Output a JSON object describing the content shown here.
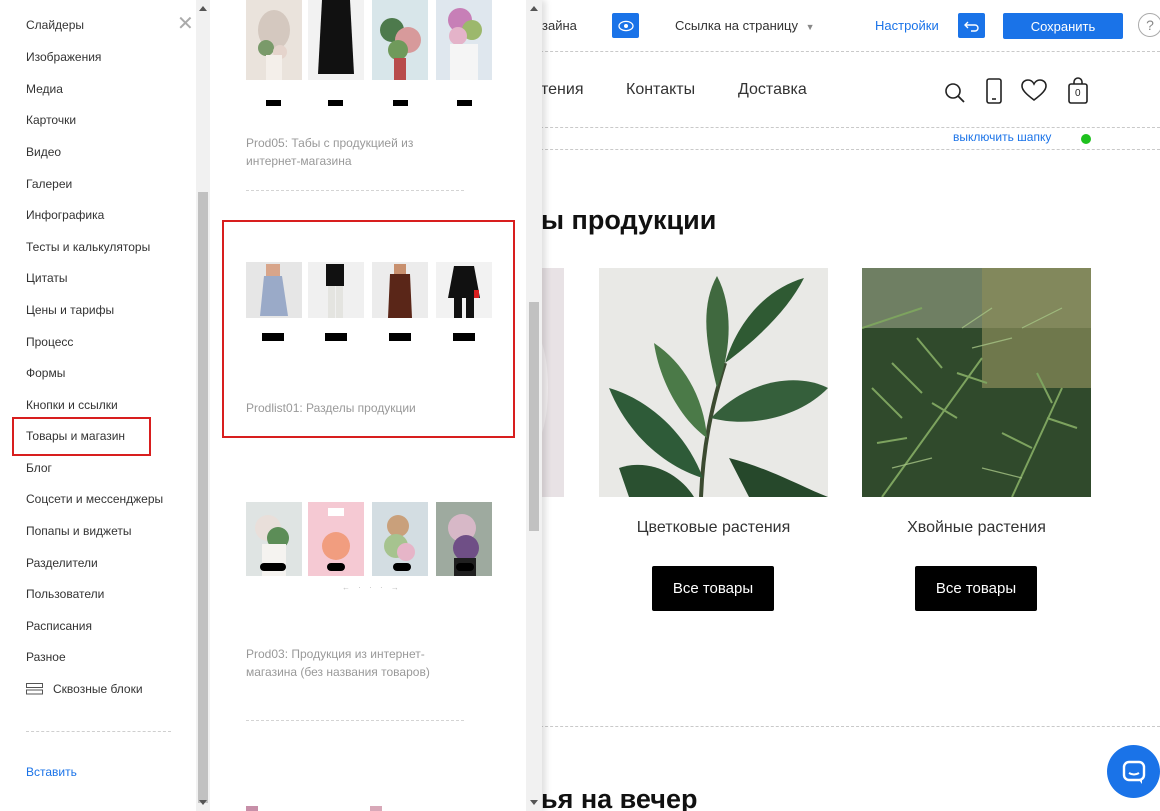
{
  "sidebar": {
    "items": [
      "Слайдеры",
      "Изображения",
      "Медиа",
      "Карточки",
      "Видео",
      "Галереи",
      "Инфографика",
      "Тесты и калькуляторы",
      "Цитаты",
      "Цены и тарифы",
      "Процесс",
      "Формы",
      "Кнопки и ссылки",
      "Товары и магазин",
      "Блог",
      "Соцсети и мессенджеры",
      "Попапы и виджеты",
      "Разделители",
      "Пользователи",
      "Расписания",
      "Разное"
    ],
    "active_item": "Товары и магазин",
    "global_blocks_label": "Сквозные блоки",
    "insert_label": "Вставить"
  },
  "catalog": {
    "block1": {
      "caption": "Prod05: Табы с продукцией из интернет-магазина"
    },
    "block2": {
      "caption": "Prodlist01: Разделы продукции"
    },
    "block3": {
      "caption": "Prod03: Продукция из интернет-магазина (без названия товаров)"
    }
  },
  "editor_toolbar": {
    "design_label": "зайна",
    "page_link_label": "Ссылка на страницу",
    "settings_label": "Настройки",
    "save_label": "Сохранить",
    "help_label": "?"
  },
  "site": {
    "nav": [
      "тения",
      "Контакты",
      "Доставка"
    ],
    "cart_count": "0",
    "hide_header_label": "выключить шапку",
    "section1_title": "ы продукции",
    "cards": [
      {
        "title": "Цветковые растения",
        "button": "Все товары"
      },
      {
        "title": "Хвойные растения",
        "button": "Все товары"
      }
    ],
    "section2_title": "ья на вечер"
  },
  "colors": {
    "accent": "#1a73e8",
    "selection": "#d81e1e",
    "status_on": "#1ec11e"
  }
}
